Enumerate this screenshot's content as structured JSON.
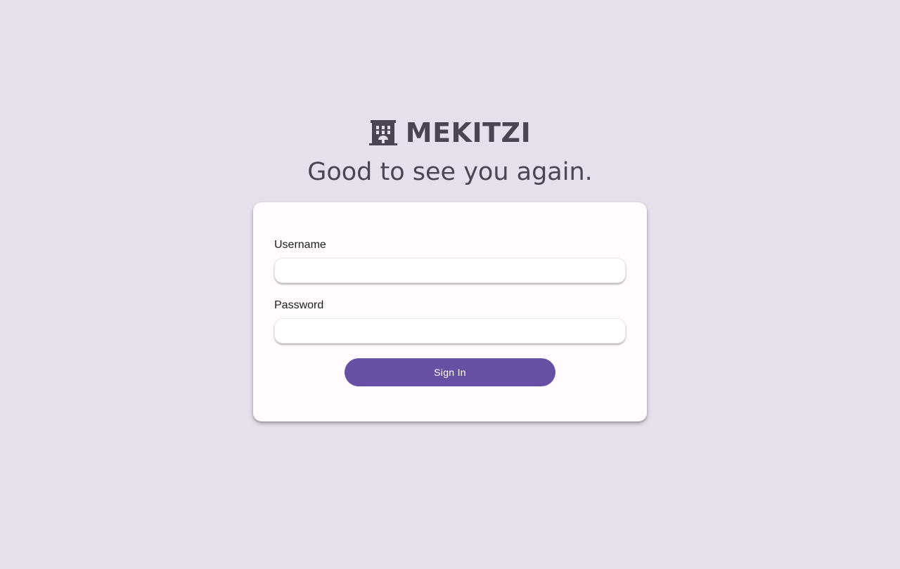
{
  "brand": {
    "icon": "building-icon",
    "name": "MEKITZI"
  },
  "tagline": "Good to see you again.",
  "login_form": {
    "username_label": "Username",
    "username_value": "",
    "username_placeholder": "",
    "password_label": "Password",
    "password_value": "",
    "password_placeholder": "",
    "submit_label": "Sign In"
  },
  "colors": {
    "background": "#e6e0ec",
    "card": "#fffbfe",
    "primary": "#6750a4",
    "heading_text": "#4a4453"
  }
}
